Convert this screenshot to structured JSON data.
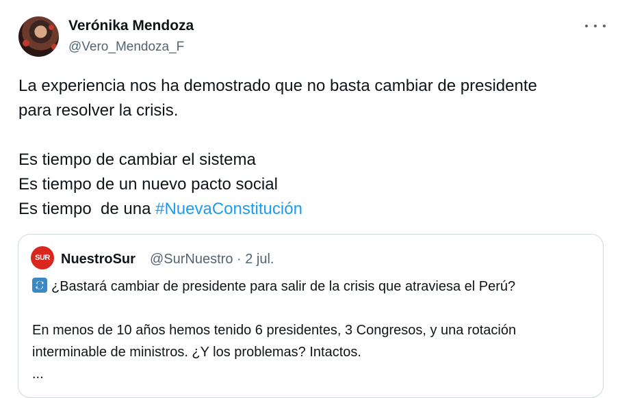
{
  "author": {
    "name": "Verónika Mendoza",
    "handle": "@Vero_Mendoza_F"
  },
  "tweet": {
    "lines": [
      "La experiencia nos ha demostrado que no basta cambiar de presidente",
      "para resolver la crisis.",
      "",
      "Es tiempo de cambiar el sistema",
      "Es tiempo de un nuevo pacto social",
      "Es tiempo  de una "
    ],
    "hashtag": "#NuevaConstitución"
  },
  "quoted": {
    "logo_text": "SUR",
    "name": "NuestroSur",
    "handle_time": "@SurNuestro · 2 jul.",
    "line1": "¿Bastará cambiar de presidente para salir de la crisis que atraviesa el Perú?",
    "line2": "En menos de 10 años hemos tenido 6 presidentes, 3 Congresos, y una rotación",
    "line3": "interminable de ministros. ¿Y los problemas? Intactos.",
    "line4": "...",
    "icon": "repeat-icon"
  },
  "colors": {
    "link": "#1d9bf0",
    "text": "#0f1419",
    "secondary": "#536471",
    "border": "#cfd9de"
  }
}
